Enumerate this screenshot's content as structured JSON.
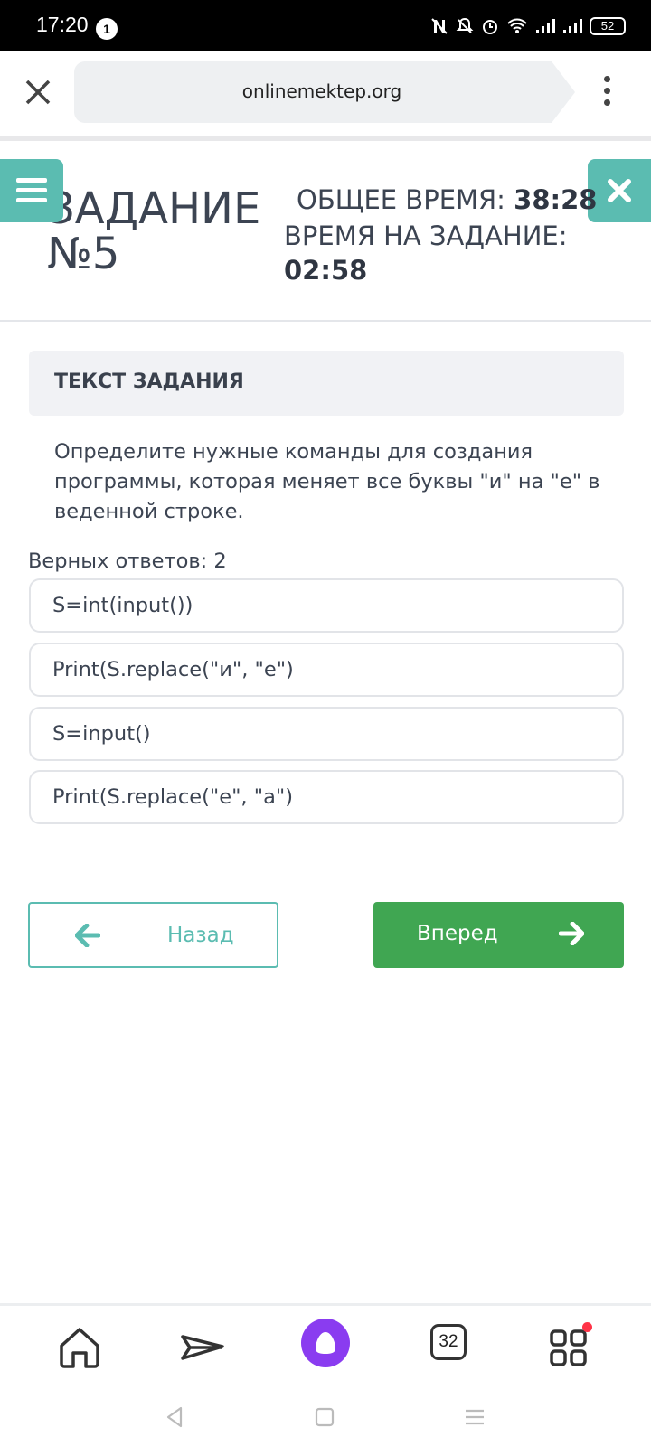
{
  "status_bar": {
    "time": "17:20",
    "notification_count": "1",
    "battery": "52",
    "icons": [
      "nfc-icon",
      "dnd-icon",
      "alarm-icon",
      "wifi-icon",
      "signal-icon",
      "signal-icon",
      "battery-icon"
    ]
  },
  "browser": {
    "url": "onlinemektep.org",
    "icons": [
      "close-icon",
      "more-vertical-icon"
    ]
  },
  "task": {
    "title_line1": "ЗАДАНИЕ",
    "title_line2": "№5",
    "total_time_label": "ОБЩЕЕ ВРЕМЯ:",
    "total_time_value": "38:28",
    "task_time_label": "ВРЕМЯ НА ЗАДАНИЕ:",
    "task_time_value": "02:58",
    "section_label": "ТЕКСТ ЗАДАНИЯ",
    "question": "Определите нужные команды для создания программы, которая меняет все буквы \"и\" на \"е\" в веденной строке.",
    "correct_answers_label": "Верных ответов: 2",
    "options": [
      "S=int(input())",
      "Print(S.replace(\"и\", \"е\")",
      "S=input()",
      "Print(S.replace(\"е\", \"а\")"
    ]
  },
  "navigation": {
    "back_label": "Назад",
    "next_label": "Вперед"
  },
  "bottom_nav": {
    "tabs_count": "32",
    "items": [
      "home-icon",
      "send-icon",
      "alice-icon",
      "tabs-icon",
      "services-icon"
    ]
  },
  "colors": {
    "accent_teal": "#5bbcb1",
    "next_green": "#40a652",
    "alice_purple": "#8a3cf0",
    "text_dark": "#3c4452"
  }
}
